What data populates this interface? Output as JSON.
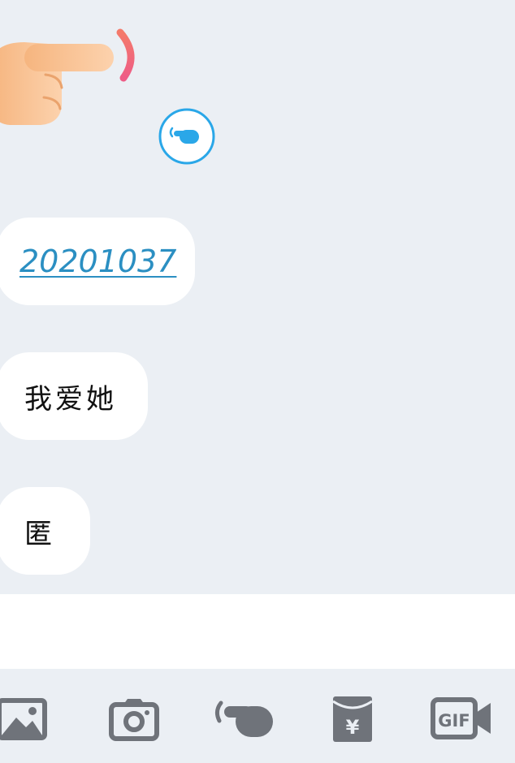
{
  "chat": {
    "messages": [
      {
        "text": "20201037",
        "type": "link"
      },
      {
        "text": "我爱她",
        "type": "text"
      },
      {
        "text": "匿",
        "type": "text"
      }
    ]
  },
  "toolbar": {
    "items": [
      {
        "icon": "image-icon"
      },
      {
        "icon": "camera-icon"
      },
      {
        "icon": "poke-icon"
      },
      {
        "icon": "red-packet-icon",
        "glyph": "¥"
      },
      {
        "icon": "gif-icon",
        "glyph": "GIF"
      }
    ]
  },
  "colors": {
    "background": "#ebeff4",
    "bubble": "#ffffff",
    "link": "#2b8fc2",
    "icon_gray": "#6f737a",
    "poke_blue": "#2aa7e8",
    "hand_skin": "#f9c08e",
    "poke_arc": "#f2607a"
  }
}
